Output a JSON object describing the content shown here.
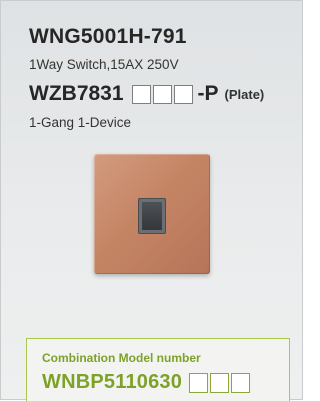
{
  "product": {
    "switch_model": "WNG5001H-791",
    "switch_spec": "1Way Switch,15AX 250V",
    "plate_model_prefix": "WZB7831",
    "plate_model_suffix": "-P",
    "plate_label": "(Plate)",
    "gang_description": "1-Gang 1-Device"
  },
  "combination": {
    "title": "Combination Model number",
    "model_prefix": "WNBP5110630"
  },
  "colors": {
    "accent_green": "#7ea12a",
    "plate_copper": "#c48565",
    "switch_gray": "#3f4347"
  }
}
